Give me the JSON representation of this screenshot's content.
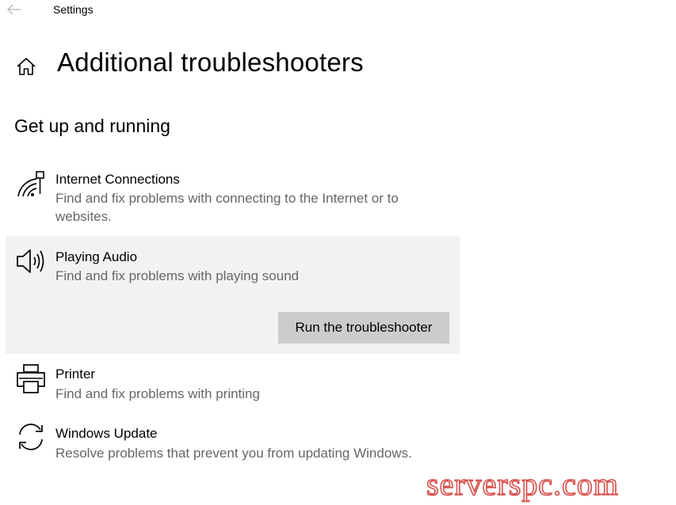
{
  "titlebar": {
    "back_icon": "back-arrow-icon",
    "app_title": "Settings"
  },
  "header": {
    "home_icon": "home-icon",
    "page_title": "Additional troubleshooters"
  },
  "section": {
    "title": "Get up and running"
  },
  "troubleshooters": [
    {
      "icon": "network-icon",
      "name": "Internet Connections",
      "description": "Find and fix problems with connecting to the Internet or to websites."
    },
    {
      "icon": "speaker-icon",
      "name": "Playing Audio",
      "description": "Find and fix problems with playing sound",
      "selected": true,
      "action_label": "Run the troubleshooter"
    },
    {
      "icon": "printer-icon",
      "name": "Printer",
      "description": "Find and fix problems with printing"
    },
    {
      "icon": "sync-icon",
      "name": "Windows Update",
      "description": "Resolve problems that prevent you from updating Windows."
    }
  ],
  "watermark": "serverspc.com",
  "colors": {
    "selected_background": "#f2f2f2",
    "button_background": "#cccccc",
    "description_text": "#666666",
    "watermark": "#d9534f"
  }
}
